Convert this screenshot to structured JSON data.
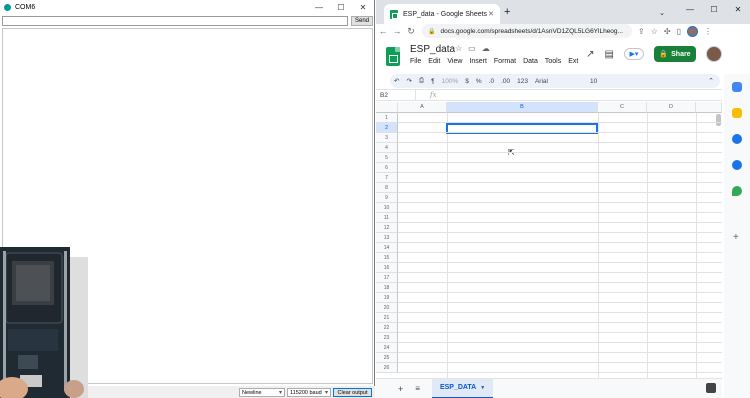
{
  "serial": {
    "title": "COM6",
    "send_label": "Send",
    "send_input_value": "",
    "newline_option": "Newline",
    "baud_option": "115200 baud",
    "clear_label": "Clear output"
  },
  "browser": {
    "tab_title": "ESP_data - Google Sheets",
    "url": "docs.google.com/spreadsheets/d/1AsnVD1ZQL5LG6YlLheog..."
  },
  "sheets": {
    "doc_name": "ESP_data",
    "menus": [
      "File",
      "Edit",
      "View",
      "Insert",
      "Format",
      "Data",
      "Tools",
      "Ext"
    ],
    "share_label": "Share",
    "toolbar": {
      "zoom": "100%",
      "currency": "$",
      "percent": "%",
      "dec_less": ".0",
      "dec_more": ".00",
      "more_formats": "123",
      "font": "Arial",
      "font_size": "10"
    },
    "name_box": "B2",
    "fx": "fx",
    "columns": [
      "A",
      "B",
      "C",
      "D"
    ],
    "rows": [
      "1",
      "2",
      "3",
      "4",
      "5",
      "6",
      "7",
      "8",
      "9",
      "10",
      "11",
      "12",
      "13",
      "14",
      "15",
      "16",
      "17",
      "18",
      "19",
      "20",
      "21",
      "22",
      "23",
      "24",
      "25",
      "26"
    ],
    "active_cell": "B2",
    "sheet_tab": "ESP_DATA"
  },
  "colors": {
    "accent": "#1a73e8",
    "share_green": "#188038",
    "sheets_green": "#0f9d58"
  }
}
